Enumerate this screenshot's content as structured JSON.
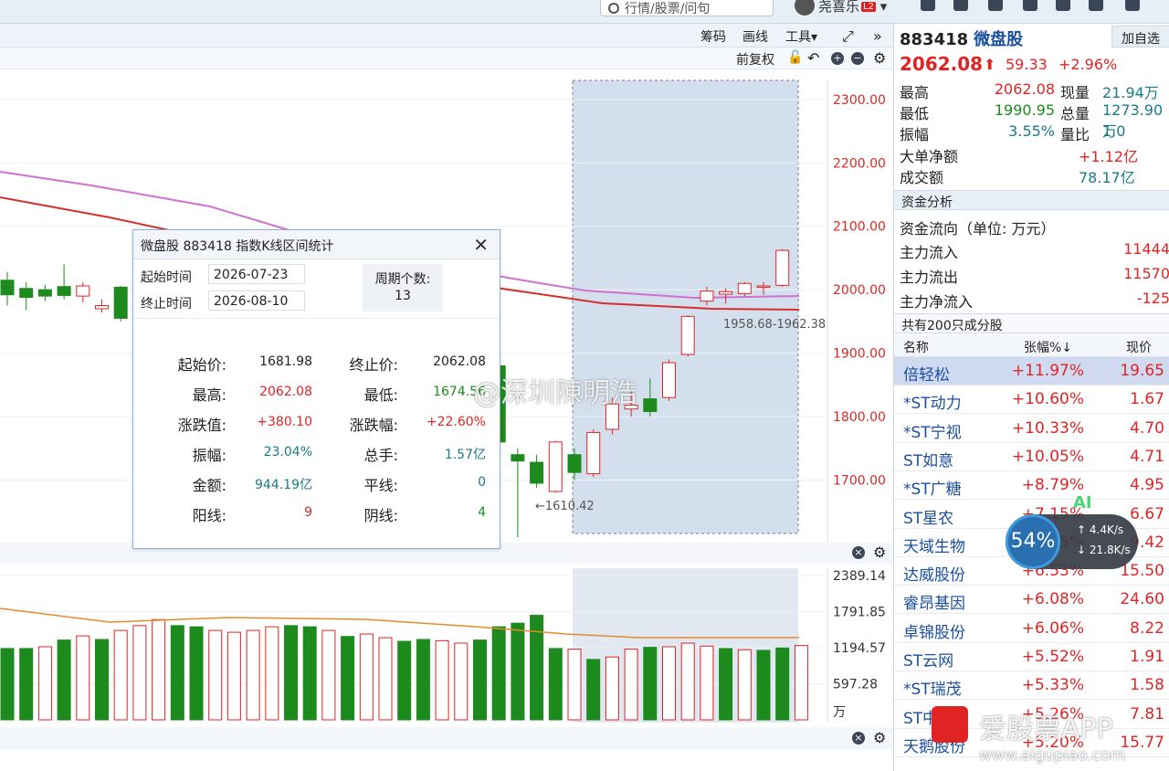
{
  "topbar": {
    "search_placeholder": "行情/股票/问句",
    "user_name": "尧喜乐",
    "user_badge": "L2"
  },
  "toolbar": {
    "chips": "筹码",
    "draw": "画线",
    "tools": "工具",
    "adjust": "前复权"
  },
  "chart_data": [
    {
      "type": "candlestick",
      "title": "",
      "y_ticks": [
        "2300.00",
        "2200.00",
        "2100.00",
        "2000.00",
        "1900.00",
        "1800.00",
        "1700.00"
      ],
      "ylim": [
        1610,
        2330
      ],
      "candles": [
        {
          "o": 1992,
          "c": 2015,
          "h": 2028,
          "l": 1975,
          "up": false
        },
        {
          "o": 1988,
          "c": 2002,
          "h": 2012,
          "l": 1968,
          "up": false
        },
        {
          "o": 1990,
          "c": 2000,
          "h": 2008,
          "l": 1982,
          "up": false
        },
        {
          "o": 1991,
          "c": 2005,
          "h": 2040,
          "l": 1985,
          "up": false
        },
        {
          "o": 2006,
          "c": 1990,
          "h": 2012,
          "l": 1980,
          "up": true
        },
        {
          "o": 1970,
          "c": 1975,
          "h": 1985,
          "l": 1964,
          "up": true
        },
        {
          "o": 1955,
          "c": 2004,
          "h": 2006,
          "l": 1950,
          "up": false
        },
        {
          "o": 1925,
          "c": 1910,
          "h": 1938,
          "l": 1895,
          "up": false
        },
        {
          "o": 1905,
          "c": 1895,
          "h": 1912,
          "l": 1880,
          "up": false
        },
        {
          "o": 1880,
          "c": 1890,
          "h": 1930,
          "l": 1860,
          "up": true
        },
        {
          "o": 1868,
          "c": 1878,
          "h": 1885,
          "l": 1850,
          "up": true
        },
        {
          "o": 1860,
          "c": 1870,
          "h": 1885,
          "l": 1845,
          "up": false
        },
        {
          "o": 1845,
          "c": 1852,
          "h": 1862,
          "l": 1835,
          "up": false
        },
        {
          "o": 1840,
          "c": 1835,
          "h": 1850,
          "l": 1828,
          "up": true
        },
        {
          "o": 1838,
          "c": 1830,
          "h": 1850,
          "l": 1822,
          "up": true
        },
        {
          "o": 1835,
          "c": 1826,
          "h": 1848,
          "l": 1820,
          "up": false
        },
        {
          "o": 1830,
          "c": 1822,
          "h": 1845,
          "l": 1815,
          "up": true
        },
        {
          "o": 1828,
          "c": 1818,
          "h": 1840,
          "l": 1810,
          "up": false
        },
        {
          "o": 1825,
          "c": 1815,
          "h": 1838,
          "l": 1808,
          "up": true
        },
        {
          "o": 1822,
          "c": 1812,
          "h": 1835,
          "l": 1805,
          "up": false
        },
        {
          "o": 1818,
          "c": 1808,
          "h": 1830,
          "l": 1800,
          "up": true
        },
        {
          "o": 1815,
          "c": 1802,
          "h": 1828,
          "l": 1795,
          "up": false
        },
        {
          "o": 1812,
          "c": 1798,
          "h": 1825,
          "l": 1790,
          "up": false
        },
        {
          "o": 1808,
          "c": 1795,
          "h": 1820,
          "l": 1785,
          "up": false
        },
        {
          "o": 1805,
          "c": 1790,
          "h": 1818,
          "l": 1780,
          "up": false
        },
        {
          "o": 1802,
          "c": 1785,
          "h": 1815,
          "l": 1775,
          "up": false
        },
        {
          "o": 1880,
          "c": 1760,
          "h": 1885,
          "l": 1750,
          "up": false
        },
        {
          "o": 1740,
          "c": 1730,
          "h": 1750,
          "l": 1610,
          "up": false
        },
        {
          "o": 1728,
          "c": 1695,
          "h": 1740,
          "l": 1688,
          "up": false
        },
        {
          "o": 1682,
          "c": 1760,
          "h": 1762,
          "l": 1680,
          "up": true
        },
        {
          "o": 1740,
          "c": 1712,
          "h": 1750,
          "l": 1700,
          "up": false
        },
        {
          "o": 1710,
          "c": 1775,
          "h": 1780,
          "l": 1705,
          "up": true
        },
        {
          "o": 1780,
          "c": 1820,
          "h": 1830,
          "l": 1772,
          "up": true
        },
        {
          "o": 1818,
          "c": 1812,
          "h": 1840,
          "l": 1800,
          "up": true
        },
        {
          "o": 1808,
          "c": 1828,
          "h": 1860,
          "l": 1800,
          "up": false
        },
        {
          "o": 1830,
          "c": 1885,
          "h": 1890,
          "l": 1825,
          "up": true
        },
        {
          "o": 1898,
          "c": 1958,
          "h": 1960,
          "l": 1895,
          "up": true
        },
        {
          "o": 1982,
          "c": 1998,
          "h": 2005,
          "l": 1975,
          "up": true
        },
        {
          "o": 1993,
          "c": 1997,
          "h": 2002,
          "l": 1978,
          "up": true
        },
        {
          "o": 1994,
          "c": 2010,
          "h": 2012,
          "l": 1990,
          "up": true
        },
        {
          "o": 2004,
          "c": 2006,
          "h": 2012,
          "l": 1992,
          "up": true
        },
        {
          "o": 2007,
          "c": 2062,
          "h": 2064,
          "l": 2005,
          "up": true
        }
      ],
      "annotations": {
        "low": "←1610.42",
        "range": "1958.68-1962.38"
      }
    },
    {
      "type": "bar",
      "title": "",
      "y_ticks": [
        "2389.14",
        "1791.85",
        "1194.57",
        "597.28"
      ],
      "unit": "万",
      "ylim": [
        0,
        2389.14
      ],
      "values": [
        1180,
        1180,
        1210,
        1320,
        1390,
        1330,
        1480,
        1560,
        1660,
        1560,
        1540,
        1480,
        1450,
        1480,
        1540,
        1560,
        1540,
        1480,
        1380,
        1420,
        1360,
        1300,
        1330,
        1310,
        1270,
        1320,
        1540,
        1600,
        1730,
        1180,
        1170,
        1000,
        1040,
        1170,
        1200,
        1210,
        1270,
        1220,
        1180,
        1160,
        1150,
        1190,
        1230
      ],
      "up": [
        false,
        false,
        true,
        false,
        true,
        false,
        true,
        true,
        true,
        false,
        false,
        true,
        true,
        true,
        true,
        false,
        false,
        true,
        false,
        true,
        true,
        false,
        false,
        true,
        true,
        false,
        false,
        false,
        false,
        false,
        true,
        false,
        true,
        true,
        false,
        true,
        true,
        true,
        false,
        true,
        false,
        false,
        true
      ]
    }
  ],
  "dialog": {
    "title": "微盘股  883418  指数K线区间统计",
    "start_label": "起始时间",
    "start_value": "2026-07-23",
    "end_label": "终止时间",
    "end_value": "2026-08-10",
    "count_label": "周期个数:",
    "count_value": "13",
    "stats": [
      {
        "l1": "起始价:",
        "v1": "1681.98",
        "c1": "black",
        "l2": "终止价:",
        "v2": "2062.08",
        "c2": "black"
      },
      {
        "l1": "最高:",
        "v1": "2062.08",
        "c1": "red",
        "l2": "最低:",
        "v2": "1674.56",
        "c2": "green"
      },
      {
        "l1": "涨跌值:",
        "v1": "+380.10",
        "c1": "red",
        "l2": "涨跌幅:",
        "v2": "+22.60%",
        "c2": "red"
      },
      {
        "l1": "振幅:",
        "v1": "23.04%",
        "c1": "teal",
        "l2": "总手:",
        "v2": "1.57亿",
        "c2": "teal"
      },
      {
        "l1": "金额:",
        "v1": "944.19亿",
        "c1": "teal",
        "l2": "平线:",
        "v2": "0",
        "c2": "teal"
      },
      {
        "l1": "阳线:",
        "v1": "9",
        "c1": "red",
        "l2": "阴线:",
        "v2": "4",
        "c2": "green"
      }
    ]
  },
  "panel": {
    "code": "883418",
    "name": "微盘股",
    "add_button": "加自选",
    "price": "2062.08",
    "change": "59.33",
    "change_pct": "+2.96%",
    "quote": [
      {
        "l1": "最高",
        "v1": "2062.08",
        "c1": "red",
        "l2": "现量",
        "v2": "21.94万",
        "c2": "teal"
      },
      {
        "l1": "最低",
        "v1": "1990.95",
        "c1": "green",
        "l2": "总量",
        "v2": "1273.90万",
        "c2": "teal"
      },
      {
        "l1": "振幅",
        "v1": "3.55%",
        "c1": "teal",
        "l2": "量比",
        "v2": "1.0",
        "c2": "teal"
      }
    ],
    "big_order_label": "大单净额",
    "big_order_value": "+1.12亿",
    "turnover_label": "成交额",
    "turnover_value": "78.17亿",
    "fund_section": "资金分析",
    "fund_unit": "资金流向（单位: 万元）",
    "fund_rows": [
      {
        "label": "主力流入",
        "value": "11444",
        "color": "red"
      },
      {
        "label": "主力流出",
        "value": "11570",
        "color": "red"
      },
      {
        "label": "主力净流入",
        "value": "-125",
        "color": "red"
      }
    ],
    "constituents_title": "共有200只成分股",
    "col_name": "名称",
    "col_pct": "张幅%↓",
    "col_price": "现价",
    "rows": [
      {
        "name": "倍轻松",
        "pct": "+11.97%",
        "price": "19.65",
        "selected": true
      },
      {
        "name": "*ST动力",
        "pct": "+10.60%",
        "price": "1.67"
      },
      {
        "name": "*ST宁视",
        "pct": "+10.33%",
        "price": "4.70"
      },
      {
        "name": "ST如意",
        "pct": "+10.05%",
        "price": "4.71"
      },
      {
        "name": "*ST广糖",
        "pct": "+8.79%",
        "price": "4.95"
      },
      {
        "name": "ST星农",
        "pct": "+7.15%",
        "price": "6.67"
      },
      {
        "name": "天域生物",
        "pct": "+7.05%",
        "price": "9.42"
      },
      {
        "name": "达威股份",
        "pct": "+6.53%",
        "price": "15.50"
      },
      {
        "name": "睿昂基因",
        "pct": "+6.08%",
        "price": "24.60"
      },
      {
        "name": "卓锦股份",
        "pct": "+6.06%",
        "price": "8.22"
      },
      {
        "name": "ST云网",
        "pct": "+5.52%",
        "price": "1.91"
      },
      {
        "name": "*ST瑞茂",
        "pct": "+5.33%",
        "price": "1.58"
      },
      {
        "name": "ST中利",
        "pct": "+5.26%",
        "price": "7.81"
      },
      {
        "name": "天鹅股份",
        "pct": "+5.20%",
        "price": "15.77"
      }
    ]
  },
  "overlay": {
    "speed_pct": "54%",
    "speed_up": "↑ 4.4K/s",
    "speed_down": "↓ 21.8K/s",
    "ai": "AI",
    "watermark_weibo": "@深圳陳明浩",
    "watermark_app": "爱股票APP",
    "watermark_url": "www.aigupiao.com"
  }
}
